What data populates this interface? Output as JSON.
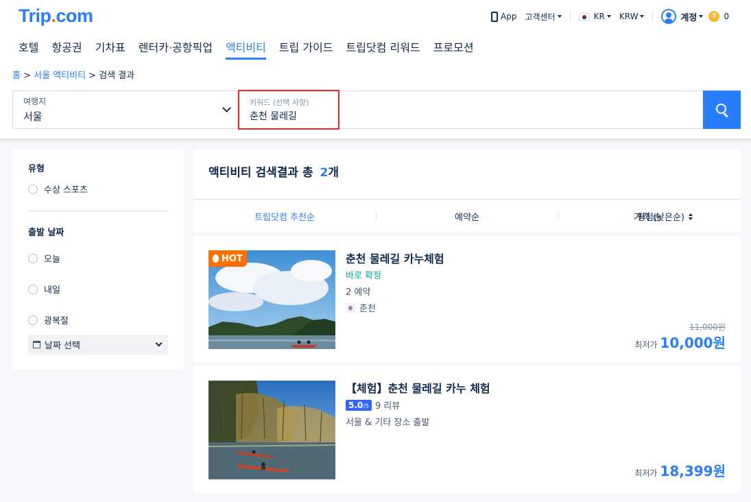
{
  "brand": {
    "logo_main": "Trip",
    "logo_dot": ".",
    "logo_tail": "com"
  },
  "topbar": {
    "app_label": "App",
    "support_label": "고객센터",
    "region_label": "KR",
    "currency_label": "KRW",
    "account_label": "계정",
    "coin_symbol": "T",
    "points": "0"
  },
  "nav": {
    "items": [
      {
        "label": "호텔"
      },
      {
        "label": "항공권"
      },
      {
        "label": "기차표"
      },
      {
        "label": "렌터카·공항픽업"
      },
      {
        "label": "액티비티"
      },
      {
        "label": "트립 가이드"
      },
      {
        "label": "트립닷컴 리워드"
      },
      {
        "label": "프로모션"
      }
    ],
    "active_index": 4
  },
  "breadcrumb": {
    "home": "홈",
    "sep1": " > ",
    "section": "서울 액티비티",
    "sep2": " > ",
    "current": "검색 결과"
  },
  "search": {
    "destination_label": "여행지",
    "destination_value": "서울",
    "keyword_label": "키워드 (선택 사항)",
    "keyword_value": "춘천 물레길"
  },
  "filters": {
    "type_title": "유형",
    "type_options": [
      {
        "label": "수상 스포츠"
      }
    ],
    "date_title": "출발 날짜",
    "date_options": [
      {
        "label": "오늘"
      },
      {
        "label": "내일"
      },
      {
        "label": "광복절"
      }
    ],
    "date_picker_label": "날짜 선택"
  },
  "results": {
    "heading_prefix": "액티비티 검색결과 총",
    "count": "2",
    "unit": "개",
    "sort_options": [
      {
        "label": "트립닷컴 추천순"
      },
      {
        "label": "예약순"
      },
      {
        "label": "평점순"
      },
      {
        "label": "가격 (낮은순)"
      }
    ],
    "items": [
      {
        "badge": "HOT",
        "title": "춘천 물레길 카누체험",
        "instant": "바로 확정",
        "booked": "2 예약",
        "location": "춘천",
        "original_price": "11,000원",
        "price_label": "최저가",
        "price": "10,000원"
      },
      {
        "title": "【체험】춘천 물레길 카누 체험",
        "rating": "5.0",
        "rating_max": "/5",
        "reviews": "9 리뷰",
        "departure": "서울 & 기타 장소 출발",
        "price_label": "최저가",
        "price": "18,399원"
      }
    ]
  },
  "colors": {
    "brand_blue": "#287dfa",
    "brand_orange": "#ff6f00",
    "highlight_red": "#e6252b",
    "teal": "#00a3a3"
  }
}
